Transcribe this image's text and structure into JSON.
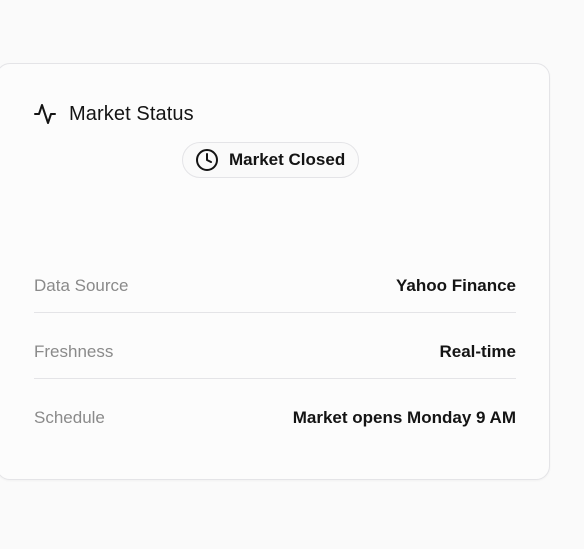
{
  "card": {
    "title": "Market Status",
    "title_icon": "activity-pulse-icon",
    "status_badge": {
      "label": "Market Closed",
      "icon": "clock-icon"
    },
    "details": [
      {
        "label": "Data Source",
        "value": "Yahoo Finance"
      },
      {
        "label": "Freshness",
        "value": "Real-time"
      },
      {
        "label": "Schedule",
        "value": "Market opens Monday 9 AM"
      }
    ]
  },
  "colors": {
    "background": "#fafafa",
    "card_border": "#e4e4e7",
    "label_text": "#8a8a8a",
    "value_text": "#141414"
  }
}
